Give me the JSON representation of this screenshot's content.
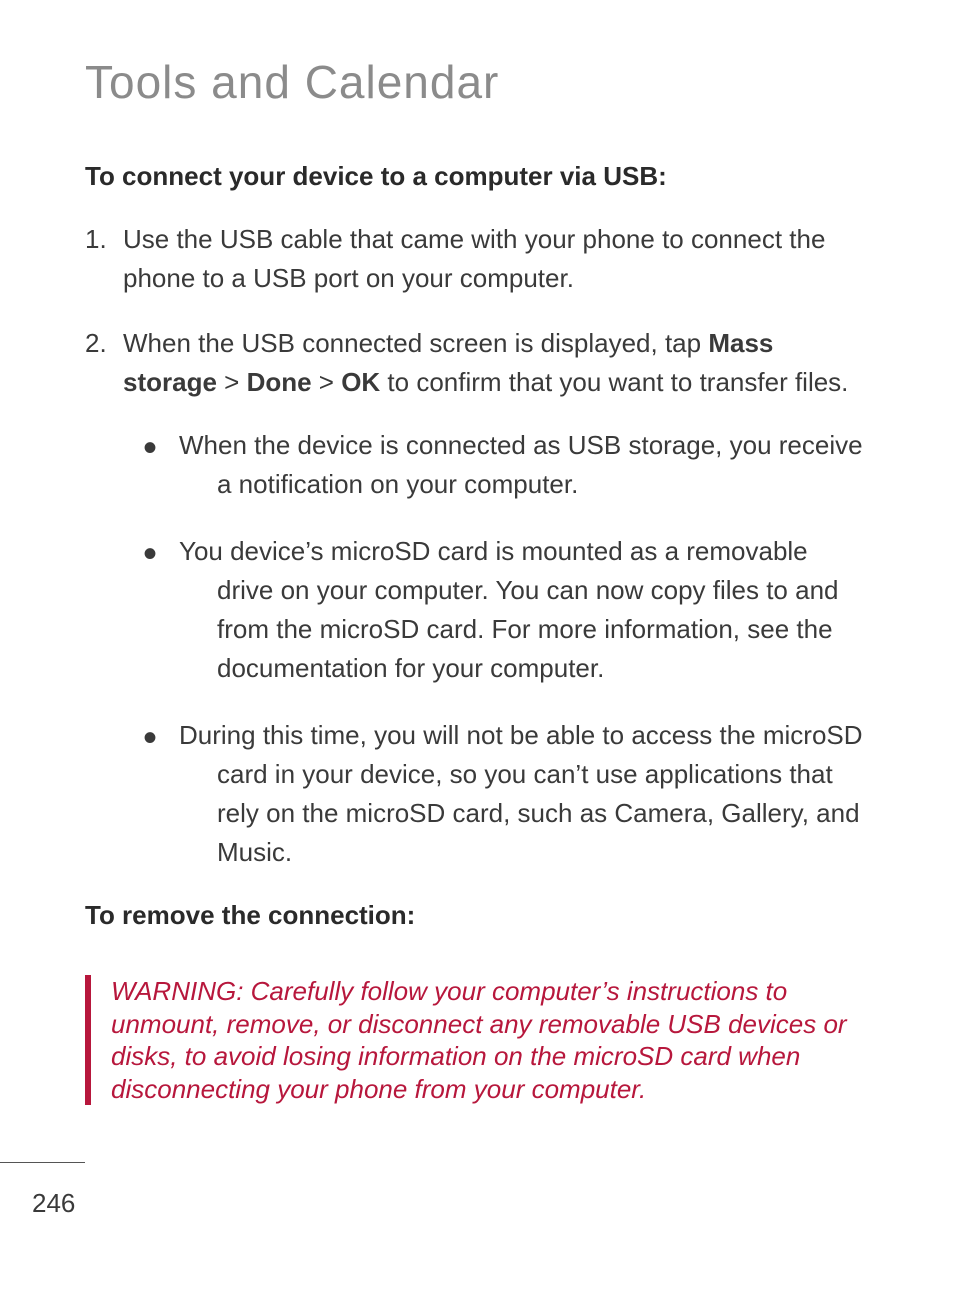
{
  "title": "Tools and Calendar",
  "section1_heading": "To connect your device to a computer via USB:",
  "step1": {
    "num": "1.",
    "text": "Use the USB cable that came with your phone to connect the phone to a USB port on your computer."
  },
  "step2": {
    "num": "2.",
    "prefix": "When the USB connected screen is displayed, tap ",
    "bold1": "Mass storage",
    "sep1": " > ",
    "bold2": "Done",
    "sep2": " > ",
    "bold3": "OK",
    "suffix": " to confirm that you want to transfer files."
  },
  "bullets": [
    "When the device is connected as USB storage, you receive a notification on your computer.",
    "You device’s microSD card is mounted as a removable drive on your computer. You can now copy files to and from the microSD card. For more information, see the documentation for your computer.",
    "During this time, you will not be able to access the microSD card in your device, so you can’t use applications that rely on the microSD card, such as Camera, Gallery, and Music."
  ],
  "section2_heading": "To remove the connection:",
  "warning": "WARNING:  Carefully follow your computer’s instructions to unmount, remove, or disconnect any removable USB devices or disks, to avoid losing information on the microSD card when disconnecting your phone from your computer.",
  "page_number": "246"
}
